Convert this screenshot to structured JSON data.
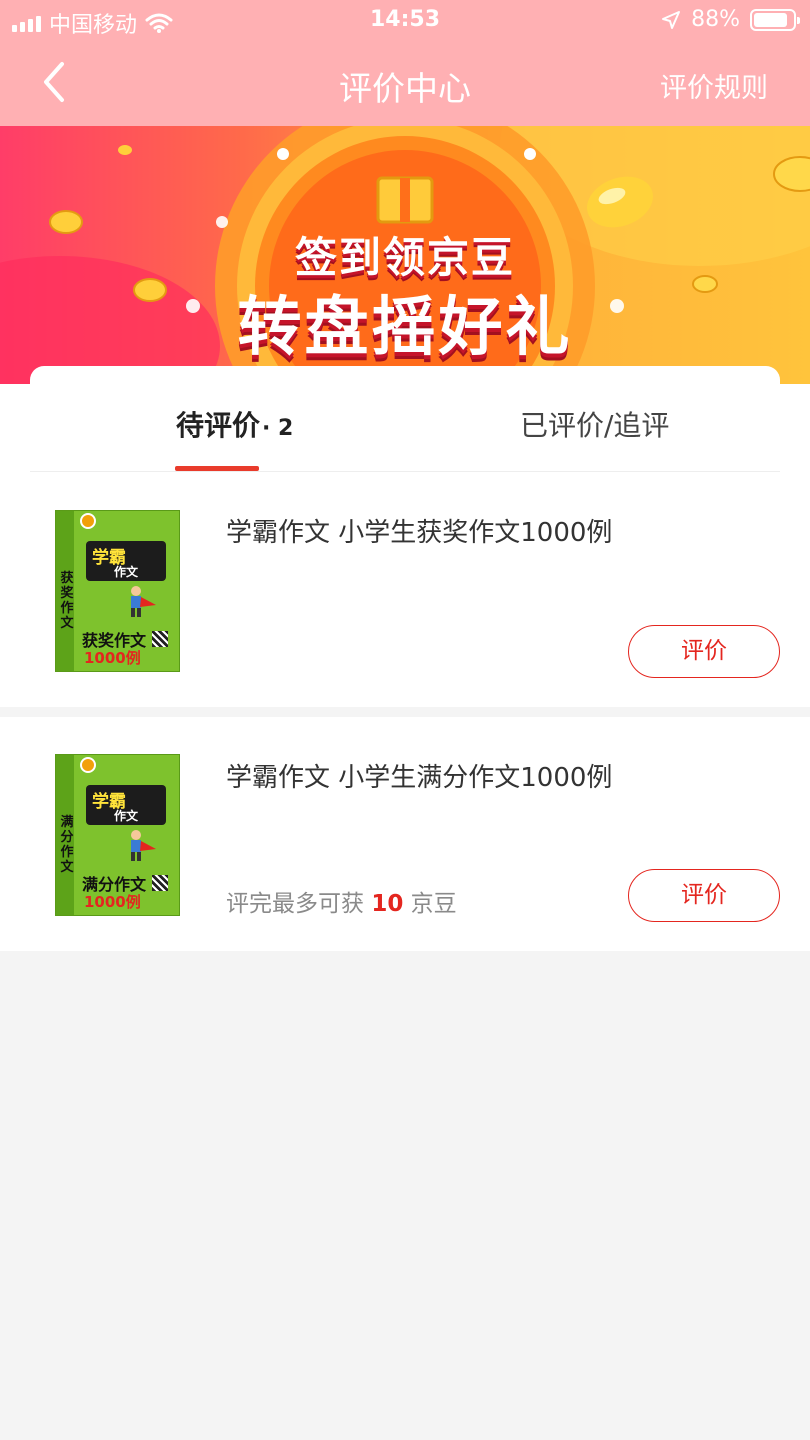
{
  "status_bar": {
    "carrier": "中国移动",
    "time": "14:53",
    "battery": "88%",
    "battery_level": 0.88
  },
  "nav": {
    "title": "评价中心",
    "rules_link": "评价规则"
  },
  "banner": {
    "line1": "签到领京豆",
    "line2": "转盘摇好礼"
  },
  "tabs": [
    {
      "label": "待评价",
      "count": "· 2"
    },
    {
      "label": "已评价/追评"
    }
  ],
  "products": [
    {
      "title": "学霸作文 小学生获奖作文1000例",
      "cover": {
        "side": "学霸作文",
        "cap": "学霸",
        "cap_sub": "作文",
        "big": "获奖作文",
        "num": "1000例",
        "spine": "获奖作文"
      },
      "button": "评价"
    },
    {
      "title": "学霸作文 小学生满分作文1000例",
      "cover": {
        "side": "学霸作文",
        "cap": "学霸",
        "cap_sub": "作文",
        "big": "满分作文",
        "num": "1000例",
        "spine": "满分作文"
      },
      "hint_prefix": "评完最多可获",
      "hint_num": "10",
      "hint_suffix": "京豆",
      "button": "评价"
    }
  ],
  "colors": {
    "nav_bg": "#ffb0b3",
    "accent": "#e4261f",
    "page_bg": "#f4f4f4"
  }
}
